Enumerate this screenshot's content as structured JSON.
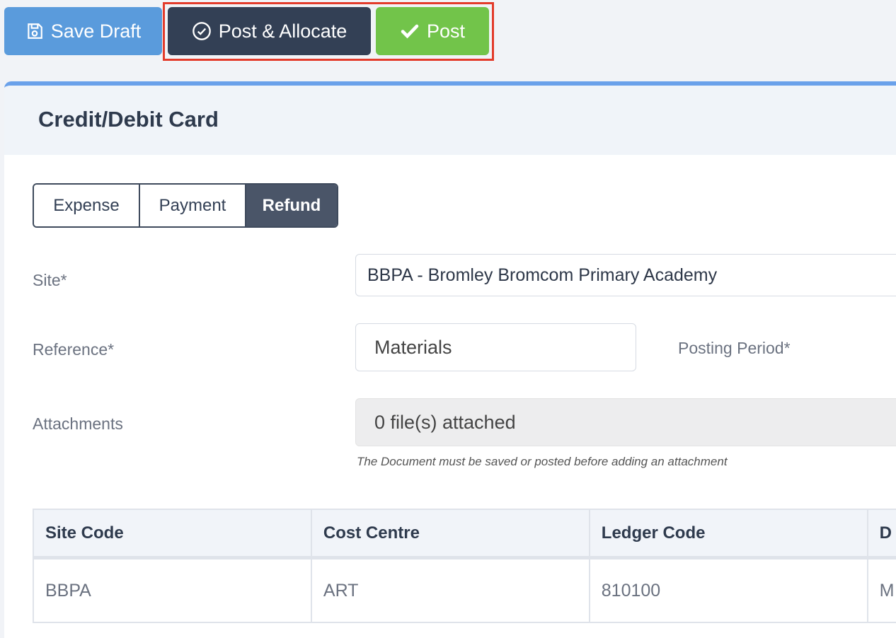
{
  "toolbar": {
    "save_draft_label": "Save Draft",
    "post_allocate_label": "Post & Allocate",
    "post_label": "Post"
  },
  "card": {
    "title": "Credit/Debit Card",
    "tabs": [
      {
        "label": "Expense",
        "active": false
      },
      {
        "label": "Payment",
        "active": false
      },
      {
        "label": "Refund",
        "active": true
      }
    ]
  },
  "form": {
    "site_label": "Site*",
    "site_value": "BBPA - Bromley Bromcom Primary Academy",
    "reference_label": "Reference*",
    "reference_value": "Materials",
    "posting_period_label": "Posting Period*",
    "attachments_label": "Attachments",
    "attachments_value": "0 file(s) attached",
    "attachments_hint": "The Document must be saved or posted before adding an attachment"
  },
  "table": {
    "headers": [
      "Site Code",
      "Cost Centre",
      "Ledger Code",
      "D"
    ],
    "rows": [
      [
        "BBPA",
        "ART",
        "810100",
        "M"
      ]
    ]
  },
  "colors": {
    "save_draft": "#5a9bdc",
    "post_allocate": "#334055",
    "post": "#72c44a",
    "highlight": "#e33b2b",
    "card_accent": "#6aa1ea"
  }
}
